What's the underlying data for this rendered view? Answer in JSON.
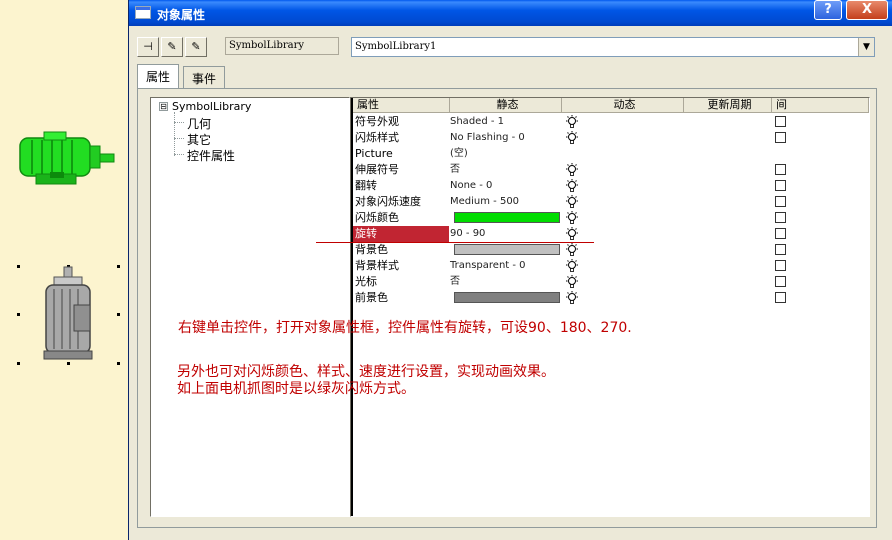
{
  "window": {
    "title": "对象属性",
    "help_label": "?",
    "close_label": "X"
  },
  "toolbar": {
    "buttons": [
      {
        "name": "pin-icon",
        "glyph": "⊣"
      },
      {
        "name": "eyedropper-icon",
        "glyph": "✎"
      },
      {
        "name": "eyedropper-alt-icon",
        "glyph": "✎"
      }
    ],
    "object_type": "SymbolLibrary",
    "object_name": "SymbolLibrary1"
  },
  "tabs": [
    {
      "label": "属性",
      "active": true
    },
    {
      "label": "事件",
      "active": false
    }
  ],
  "tree": {
    "root": "SymbolLibrary",
    "expander": "⊟",
    "children": [
      "几何",
      "其它",
      "控件属性"
    ]
  },
  "grid": {
    "headers": {
      "property": "属性",
      "static": "静态",
      "dynamic": "动态",
      "update_cycle": "更新周期",
      "indirect": "间"
    },
    "rows": [
      {
        "name": "符号外观",
        "value": "Shaded - 1",
        "dynamic": true,
        "checkbox": true
      },
      {
        "name": "闪烁样式",
        "value": "No Flashing - 0",
        "dynamic": true,
        "checkbox": true
      },
      {
        "name": "Picture",
        "value": "(空)",
        "dynamic": false,
        "checkbox": false
      },
      {
        "name": "伸展符号",
        "value": "否",
        "dynamic": true,
        "checkbox": true
      },
      {
        "name": "翻转",
        "value": "None - 0",
        "dynamic": true,
        "checkbox": true
      },
      {
        "name": "对象闪烁速度",
        "value": "Medium - 500",
        "dynamic": true,
        "checkbox": true
      },
      {
        "name": "闪烁颜色",
        "value": "",
        "swatch": "#00dd00",
        "dynamic": true,
        "checkbox": true
      },
      {
        "name": "旋转",
        "value": "90 - 90",
        "dynamic": true,
        "checkbox": true,
        "selected": true
      },
      {
        "name": "背景色",
        "value": "",
        "swatch": "#c0c0c0",
        "dynamic": true,
        "checkbox": true
      },
      {
        "name": "背景样式",
        "value": "Transparent - 0",
        "dynamic": true,
        "checkbox": true
      },
      {
        "name": "光标",
        "value": "否",
        "dynamic": true,
        "checkbox": true
      },
      {
        "name": "前景色",
        "value": "",
        "swatch": "#808080",
        "dynamic": true,
        "checkbox": true
      }
    ]
  },
  "annotations": {
    "line1": "右键单击控件，打开对象属性框，控件属性有旋转，可设90、180、270.",
    "line2": "另外也可对闪烁颜色、样式、速度进行设置，实现动画效果。",
    "line3": "如上面电机抓图时是以绿灰闪烁方式。"
  },
  "colors": {
    "title_bar": "#0054e3",
    "selected_row": "#c12532",
    "annotation_text": "#c00000",
    "motor_green": "#22dd22",
    "motor_gray": "#a0a0a0"
  }
}
